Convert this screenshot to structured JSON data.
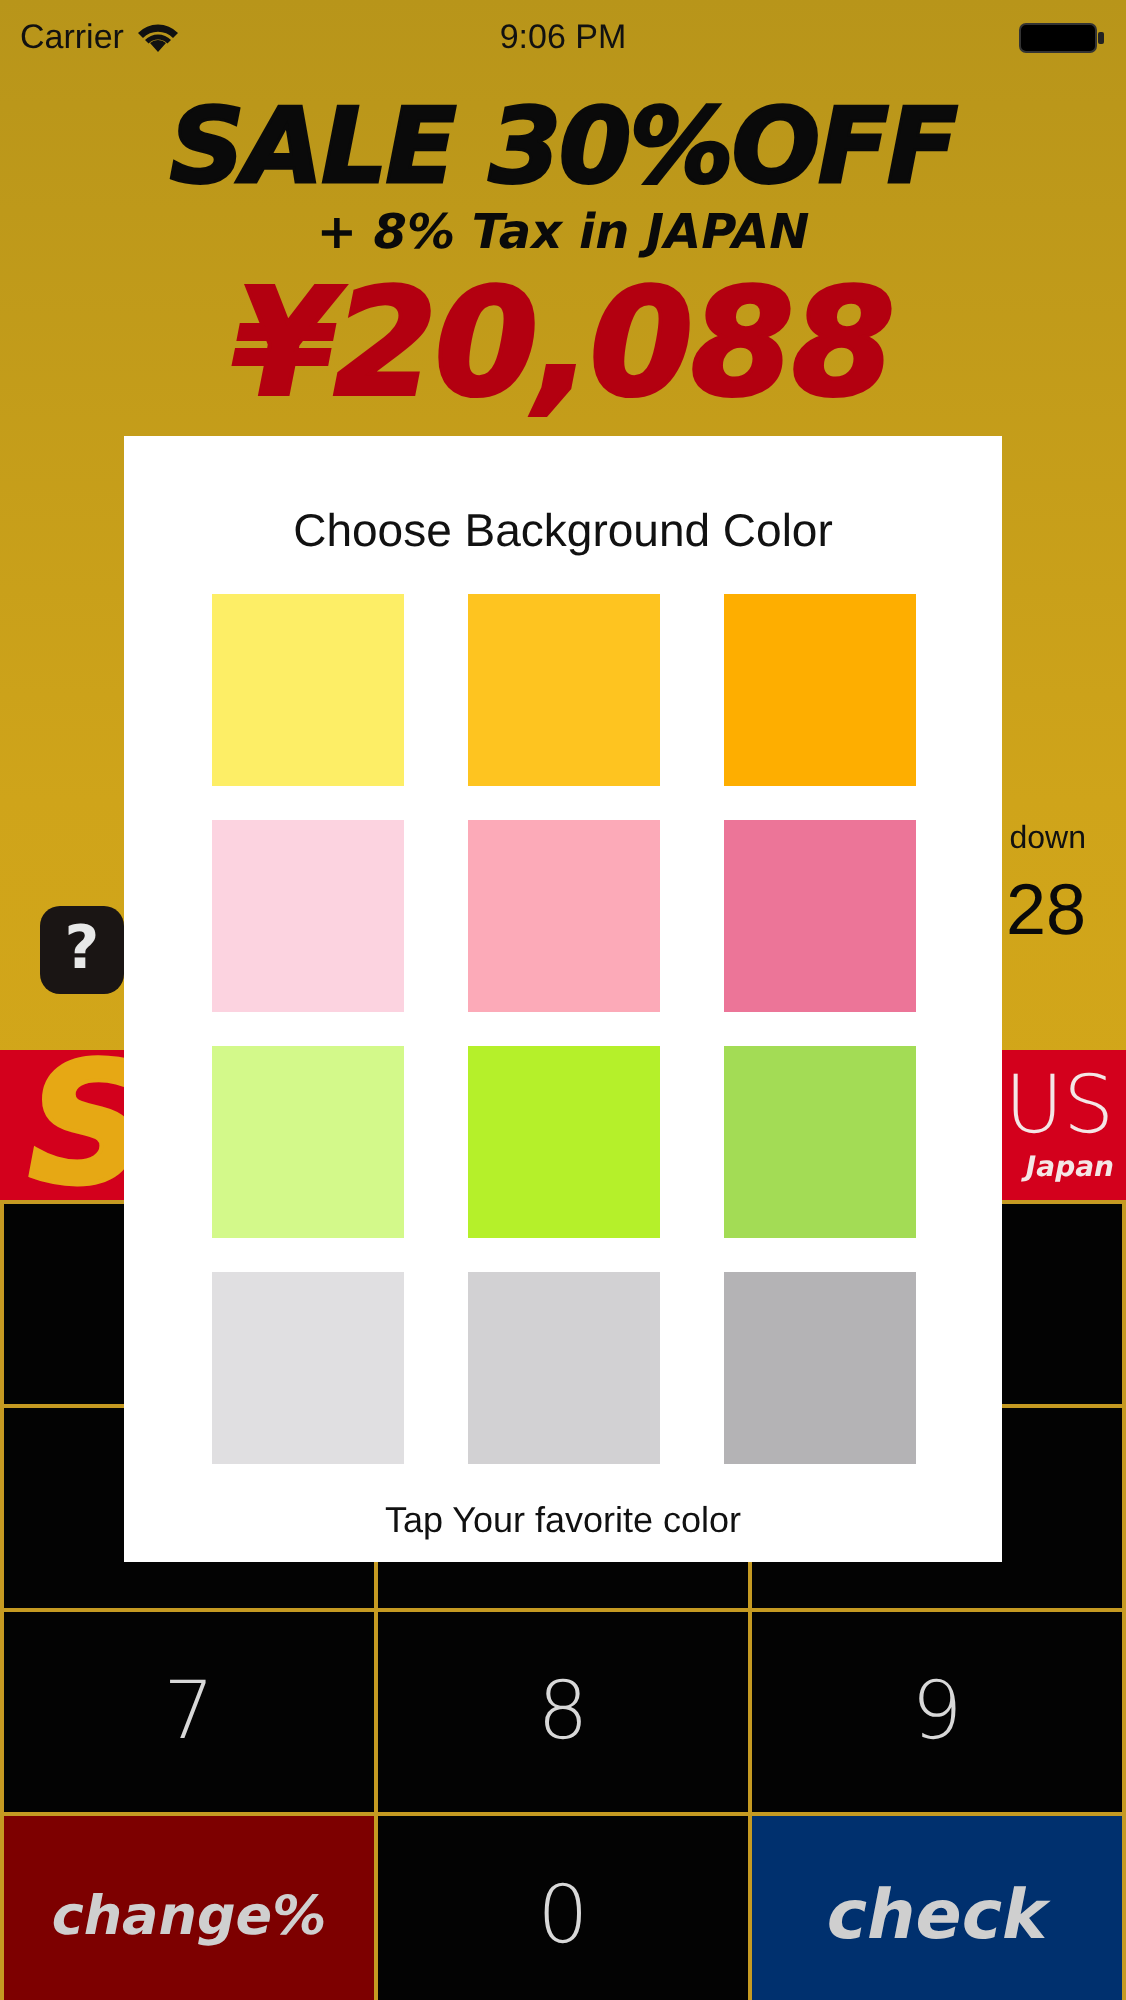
{
  "status_bar": {
    "carrier": "Carrier",
    "time": "9:06 PM"
  },
  "headline": "SALE 30%OFF",
  "subtitle": "+ 8% Tax in JAPAN",
  "price": "¥20,088",
  "side": {
    "help": "?",
    "label": "down",
    "value": "28"
  },
  "banner": {
    "left": "S",
    "right": "US",
    "right_sub": "Japan"
  },
  "keys": [
    {
      "label": "7",
      "kind": "digit"
    },
    {
      "label": "8",
      "kind": "digit"
    },
    {
      "label": "9",
      "kind": "digit"
    },
    {
      "label": "change%",
      "kind": "change"
    },
    {
      "label": "0",
      "kind": "digit"
    },
    {
      "label": "check",
      "kind": "check"
    }
  ],
  "dialog": {
    "title": "Choose Background Color",
    "swatches": [
      {
        "color": "#fdee66"
      },
      {
        "color": "#fec420"
      },
      {
        "color": "#feae00"
      },
      {
        "color": "#fcd3e0"
      },
      {
        "color": "#fcaab8"
      },
      {
        "color": "#ec7598"
      },
      {
        "color": "#d3f98a"
      },
      {
        "color": "#b5f02a"
      },
      {
        "color": "#a3dc55"
      },
      {
        "color": "#e0dfe1"
      },
      {
        "color": "#d2d1d3"
      },
      {
        "color": "#b4b3b5"
      }
    ],
    "footer": "Tap Your favorite color"
  }
}
